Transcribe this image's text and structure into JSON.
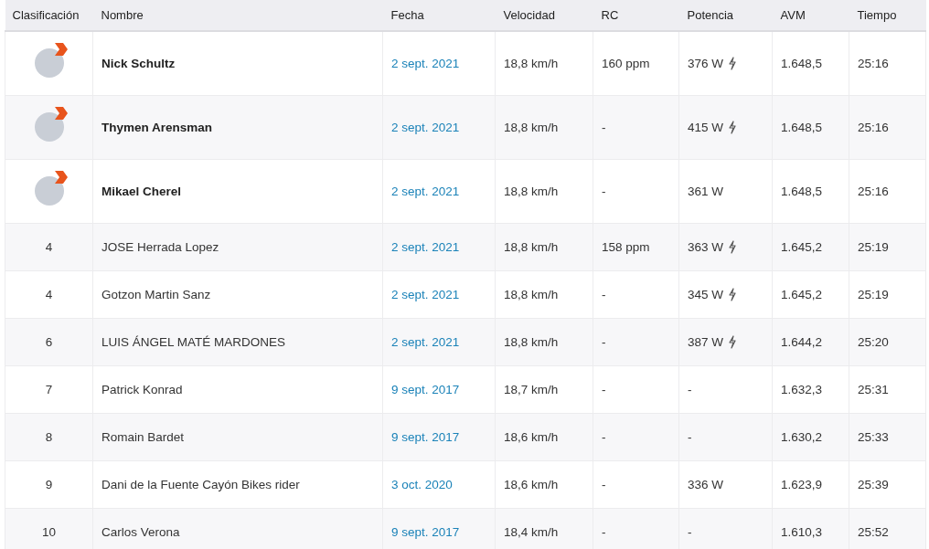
{
  "table": {
    "columns": [
      "Clasificación",
      "Nombre",
      "Fecha",
      "Velocidad",
      "RC",
      "Potencia",
      "AVM",
      "Tiempo"
    ],
    "rows": [
      {
        "kind": "podium",
        "rank": "",
        "name": "Nick Schultz",
        "date": "2 sept. 2021",
        "speed": "18,8 km/h",
        "hr": "160 ppm",
        "power": "376 W",
        "power_meter": true,
        "avm": "1.648,5",
        "time": "25:16"
      },
      {
        "kind": "podium",
        "rank": "",
        "name": "Thymen Arensman",
        "date": "2 sept. 2021",
        "speed": "18,8 km/h",
        "hr": "-",
        "power": "415 W",
        "power_meter": true,
        "avm": "1.648,5",
        "time": "25:16"
      },
      {
        "kind": "podium",
        "rank": "",
        "name": "Mikael Cherel",
        "date": "2 sept. 2021",
        "speed": "18,8 km/h",
        "hr": "-",
        "power": "361 W",
        "power_meter": false,
        "avm": "1.648,5",
        "time": "25:16"
      },
      {
        "kind": "rank",
        "rank": "4",
        "name": "JOSE Herrada Lopez",
        "date": "2 sept. 2021",
        "speed": "18,8 km/h",
        "hr": "158 ppm",
        "power": "363 W",
        "power_meter": true,
        "avm": "1.645,2",
        "time": "25:19"
      },
      {
        "kind": "rank",
        "rank": "4",
        "name": "Gotzon Martin Sanz",
        "date": "2 sept. 2021",
        "speed": "18,8 km/h",
        "hr": "-",
        "power": "345 W",
        "power_meter": true,
        "avm": "1.645,2",
        "time": "25:19"
      },
      {
        "kind": "rank",
        "rank": "6",
        "name": "LUIS ÁNGEL MATÉ MARDONES",
        "date": "2 sept. 2021",
        "speed": "18,8 km/h",
        "hr": "-",
        "power": "387 W",
        "power_meter": true,
        "avm": "1.644,2",
        "time": "25:20"
      },
      {
        "kind": "rank",
        "rank": "7",
        "name": "Patrick Konrad",
        "date": "9 sept. 2017",
        "speed": "18,7 km/h",
        "hr": "-",
        "power": "-",
        "power_meter": false,
        "avm": "1.632,3",
        "time": "25:31"
      },
      {
        "kind": "rank",
        "rank": "8",
        "name": "Romain Bardet",
        "date": "9 sept. 2017",
        "speed": "18,6 km/h",
        "hr": "-",
        "power": "-",
        "power_meter": false,
        "avm": "1.630,2",
        "time": "25:33"
      },
      {
        "kind": "rank",
        "rank": "9",
        "name": "Dani de la Fuente Cayón Bikes rider",
        "date": "3 oct. 2020",
        "speed": "18,6 km/h",
        "hr": "-",
        "power": "336 W",
        "power_meter": false,
        "avm": "1.623,9",
        "time": "25:39"
      },
      {
        "kind": "rank",
        "rank": "10",
        "name": "Carlos Verona",
        "date": "9 sept. 2017",
        "speed": "18,4 km/h",
        "hr": "-",
        "power": "-",
        "power_meter": false,
        "avm": "1.610,3",
        "time": "25:52"
      }
    ]
  }
}
